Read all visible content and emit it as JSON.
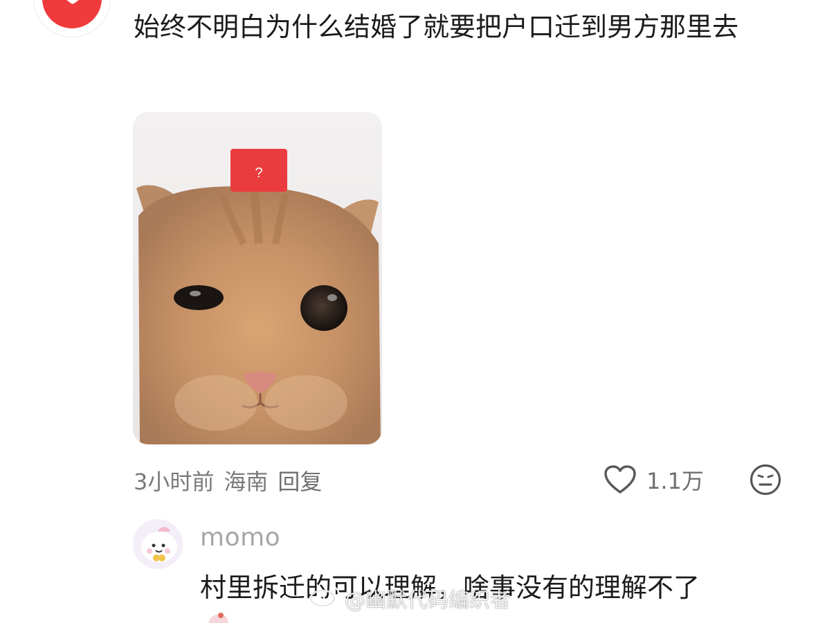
{
  "post": {
    "comment_text": "始终不明白为什么结婚了就要把户口迁到男方那里去",
    "image": {
      "sign_text": "?"
    },
    "time": "3小时前",
    "location": "海南",
    "reply_label": "回复",
    "like_count": "1.1万"
  },
  "reply": {
    "username": "momo",
    "text": "村里拆迁的可以理解，啥事没有的理解不了"
  },
  "watermark": {
    "text": "@幽默代码编织者"
  },
  "icons": {
    "top_avatar": "play-icon",
    "like": "heart-icon",
    "reaction": "neutral-face-icon",
    "watermark_logo": "weibo-icon"
  },
  "colors": {
    "brand_red": "#ef3b3b",
    "meta_gray": "#7a7a7a",
    "username_gray": "#a6a6a6"
  }
}
